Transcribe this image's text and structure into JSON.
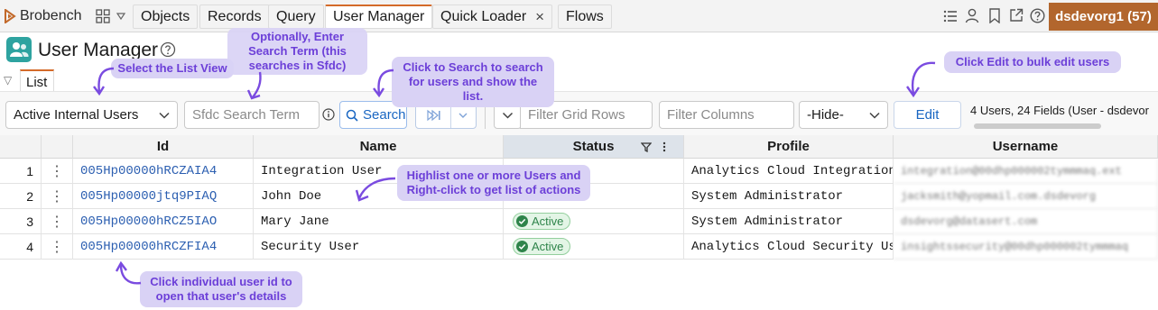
{
  "nav": {
    "brand": "Brobench",
    "tabs": [
      "Objects",
      "Records",
      "Query",
      "User Manager",
      "Quick Loader",
      "Flows"
    ],
    "close_glyph": "×",
    "org_badge": "dsdevorg1 (57)",
    "icons": [
      "apps-grid-icon",
      "list-icon",
      "user-icon",
      "bookmark-icon",
      "external-link-icon",
      "help-icon"
    ]
  },
  "page": {
    "title": "User Manager",
    "subtab": "List"
  },
  "toolbar": {
    "list_view": "Active Internal Users",
    "search_placeholder": "Sfdc Search Term",
    "search_label": "Search",
    "filter_rows_placeholder": "Filter Grid Rows",
    "filter_columns_placeholder": "Filter Columns",
    "hide_select": "-Hide-",
    "edit_label": "Edit",
    "status_text": "4 Users, 24 Fields (User - dsdevor"
  },
  "table": {
    "columns": [
      "Id",
      "Name",
      "Status",
      "Profile",
      "Username"
    ],
    "rows": [
      {
        "num": "1",
        "id": "005Hp00000hRCZAIA4",
        "name": "Integration User",
        "status": "",
        "profile": "Analytics Cloud Integration",
        "username": "integration@00dhp000002tymmmaq.ext"
      },
      {
        "num": "2",
        "id": "005Hp00000jtq9PIAQ",
        "name": "John Doe",
        "status": "",
        "profile": "System Administrator",
        "username": "jacksmith@yopmail.com.dsdevorg"
      },
      {
        "num": "3",
        "id": "005Hp00000hRCZ5IAO",
        "name": "Mary Jane",
        "status": "Active",
        "profile": "System Administrator",
        "username": "dsdevorg@datasert.com"
      },
      {
        "num": "4",
        "id": "005Hp00000hRCZFIA4",
        "name": "Security User",
        "status": "Active",
        "profile": "Analytics Cloud Security Use",
        "username": "insightssecurity@00dhp000002tymmmaq"
      }
    ]
  },
  "annotations": {
    "select_list_view": "Select the List View",
    "search_term": "Optionally, Enter Search Term (this searches in Sfdc)",
    "click_search": "Click to Search to search for users and show the list.",
    "click_edit": "Click Edit to bulk edit users",
    "highlight": "Highlist one or more Users and Right-click to get list of actions",
    "click_id": "Click individual user id to open that user's details"
  },
  "colors": {
    "accent": "#d46a29",
    "org_badge": "#b2662d",
    "callout_bg": "#d9d2f5",
    "callout_text": "#6c3fd8",
    "active_green": "#2e844a",
    "link": "#2c5fb1"
  }
}
